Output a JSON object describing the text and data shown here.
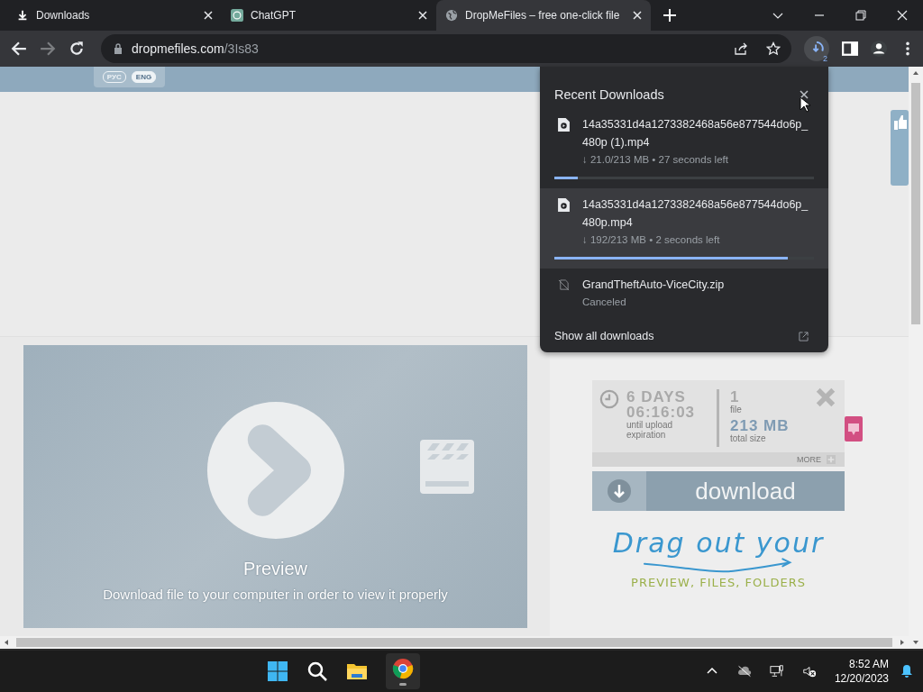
{
  "tabs": [
    {
      "title": "Downloads",
      "kind": "download",
      "selected": false
    },
    {
      "title": "ChatGPT",
      "kind": "chatgpt",
      "selected": false
    },
    {
      "title": "DropMeFiles – free one-click file",
      "kind": "globe",
      "selected": true
    }
  ],
  "address": {
    "domain": "dropmefiles.com",
    "path": "/3Is83"
  },
  "downloads_badge": "2",
  "page": {
    "languages": [
      {
        "label": "РУС",
        "selected": false
      },
      {
        "label": "ENG",
        "selected": true
      }
    ],
    "preview": {
      "title": "Preview",
      "subtitle": "Download file to your computer in order to view it properly"
    },
    "expiry": {
      "days": "6 DAYS",
      "time": "06:16:03",
      "caption": "until upload expiration"
    },
    "files": {
      "count": "1",
      "count_label": "file",
      "size": "213 MB",
      "size_label": "total size"
    },
    "more": "MORE",
    "download_button": "download",
    "drag": {
      "headline": "Drag out your",
      "sub": "PREVIEW, FILES, FOLDERS"
    }
  },
  "downloads_panel": {
    "title": "Recent Downloads",
    "items": [
      {
        "name": "14a35331d4a1273382468a56e877544do6p_480p (1).mp4",
        "status": "↓ 21.0/213 MB • 27 seconds left",
        "kind": "downloading",
        "level": 0.09,
        "selected": false
      },
      {
        "name": "14a35331d4a1273382468a56e877544do6p_480p.mp4",
        "status": "↓ 192/213 MB • 2 seconds left",
        "kind": "downloading",
        "level": 0.9,
        "selected": true
      },
      {
        "name": "GrandTheftAuto-ViceCity.zip",
        "status": "Canceled",
        "kind": "canceled",
        "selected": false
      }
    ],
    "footer": "Show all downloads"
  },
  "taskbar": {
    "time": "8:52 AM",
    "date": "12/20/2023"
  }
}
